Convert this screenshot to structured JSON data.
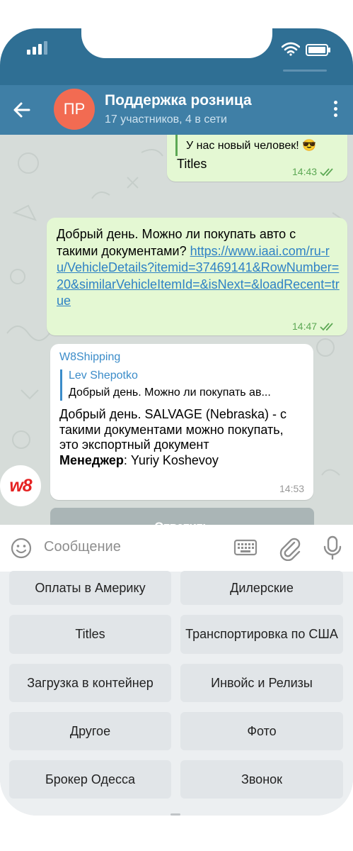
{
  "header": {
    "avatar_initials": "ПР",
    "title": "Поддержка розница",
    "subtitle": "17 участников, 4 в сети"
  },
  "messages": {
    "m1": {
      "quote_text": "У нас новый человек! 😎",
      "text": "Titles",
      "time": "14:43"
    },
    "m2": {
      "text": "Добрый день. Можно ли покупать авто с такими документами?",
      "link": "https://www.iaai.com/ru-ru/VehicleDetails?itemid=37469141&RowNumber=20&similarVehicleItemId=&isNext=&loadRecent=true",
      "time": "14:47"
    },
    "m3": {
      "sender": "W8Shipping",
      "quote_name": "Lev Shepotko",
      "quote_text": "Добрый день. Можно ли покупать ав...",
      "text": "Добрый день. SALVAGE (Nebraska) - с такими документами можно покупать, это экспортный документ",
      "manager_label": "Менеджер",
      "manager_name": ": Yuriy Koshevoy",
      "time": "14:53",
      "avatar_text": "w8"
    }
  },
  "reply_button": "Ответить",
  "input": {
    "placeholder": "Сообщение"
  },
  "keyboard": {
    "buttons": [
      "Оплаты в Америку",
      "Дилерские",
      "Titles",
      "Транспортировка по США",
      "Загрузка в контейнер",
      "Инвойс и Релизы",
      "Другое",
      "Фото",
      "Брокер Одесса",
      "Звонок"
    ]
  },
  "colors": {
    "header": "#3f7fa6",
    "statusbar": "#2f6f94",
    "outgoing_bubble": "#e4f8d3",
    "incoming_bubble": "#ffffff",
    "link": "#2f82c5",
    "avatar": "#f26b52",
    "reply_button": "#aab5b6"
  },
  "icons": [
    "signal-icon",
    "wifi-icon",
    "battery-icon",
    "back-arrow-icon",
    "more-vert-icon",
    "read-ticks-icon",
    "emoji-icon",
    "keyboard-icon",
    "attach-icon",
    "mic-icon"
  ]
}
